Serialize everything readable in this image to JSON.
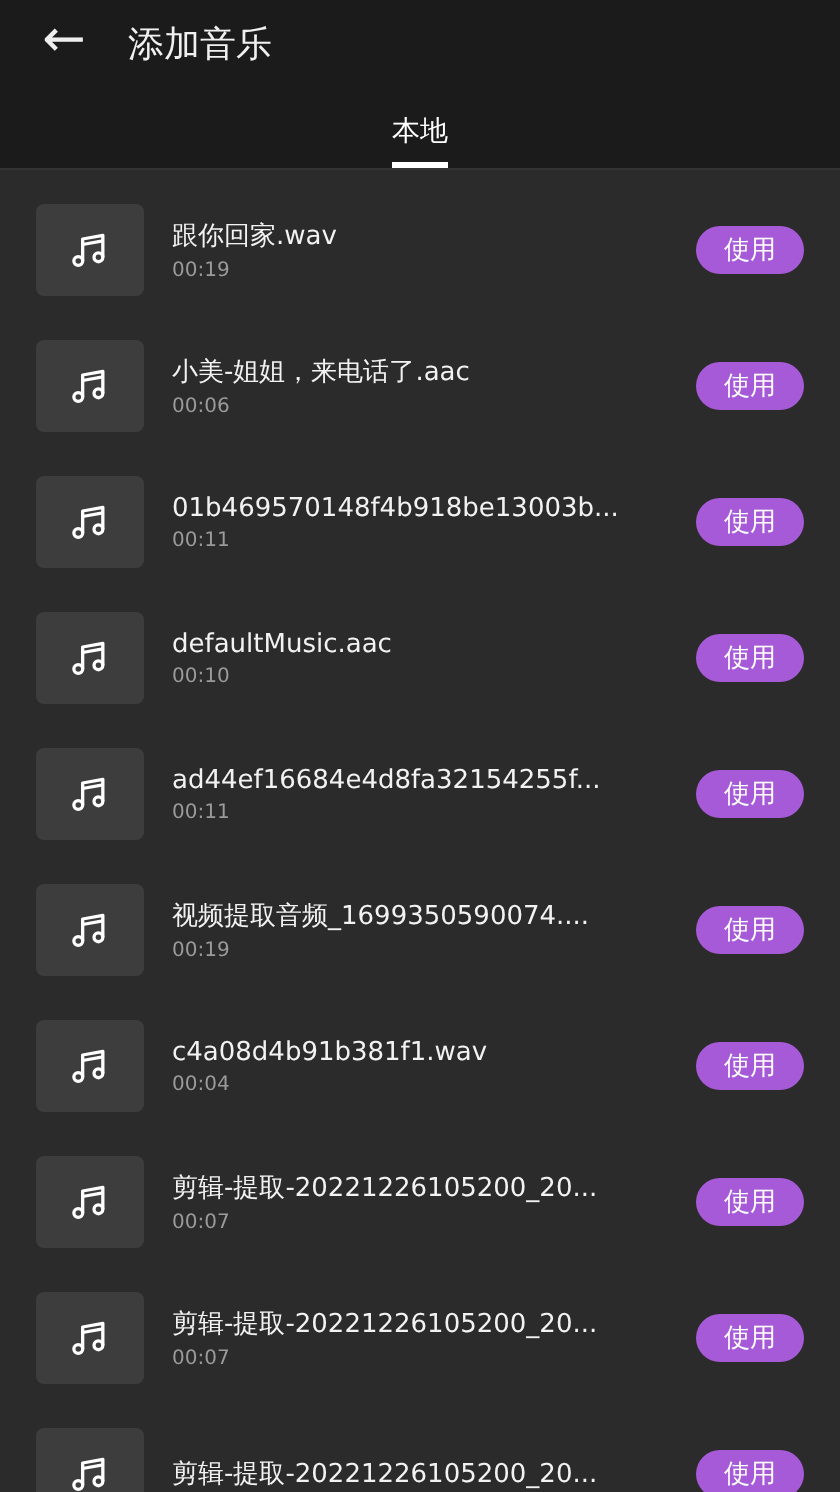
{
  "header": {
    "back": "←",
    "title": "添加音乐"
  },
  "tabs": [
    {
      "label": "本地",
      "selected": true
    }
  ],
  "tracks": [
    {
      "name": "跟你回家.wav",
      "duration": "00:19",
      "action": "使用"
    },
    {
      "name": "小美-姐姐，来电话了.aac",
      "duration": "00:06",
      "action": "使用"
    },
    {
      "name": "01b469570148f4b918be13003b...",
      "duration": "00:11",
      "action": "使用"
    },
    {
      "name": "defaultMusic.aac",
      "duration": "00:10",
      "action": "使用"
    },
    {
      "name": "ad44ef16684e4d8fa32154255f...",
      "duration": "00:11",
      "action": "使用"
    },
    {
      "name": "视频提取音频_1699350590074....",
      "duration": "00:19",
      "action": "使用"
    },
    {
      "name": "c4a08d4b91b381f1.wav",
      "duration": "00:04",
      "action": "使用"
    },
    {
      "name": "剪辑-提取-20221226105200_20...",
      "duration": "00:07",
      "action": "使用"
    },
    {
      "name": "剪辑-提取-20221226105200_20...",
      "duration": "00:07",
      "action": "使用"
    },
    {
      "name": "剪辑-提取-20221226105200_20...",
      "action": "使用"
    }
  ]
}
